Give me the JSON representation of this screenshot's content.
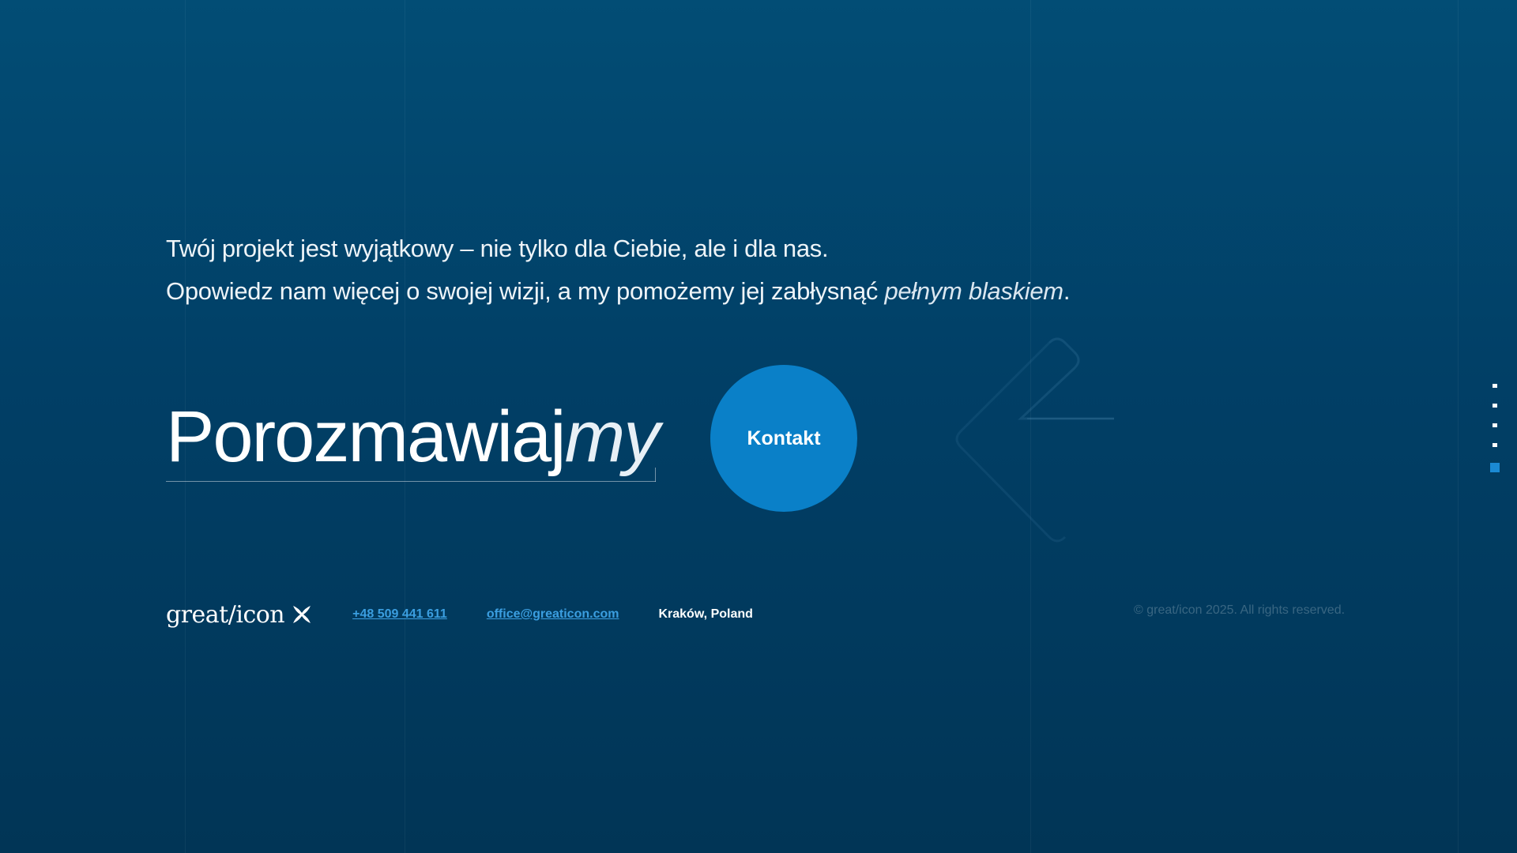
{
  "intro": {
    "line1": "Twój projekt jest wyjątkowy – nie tylko dla Ciebie, ale i dla nas.",
    "line2_start": "Opowiedz nam więcej o swojej wizji, a my pomożemy jej zabłysnąć ",
    "line2_emphasis": "pełnym blaskiem",
    "line2_end": "."
  },
  "heading": {
    "main": "Porozmawiaj",
    "italic": "my"
  },
  "contact_button": {
    "label": "Kontakt"
  },
  "footer": {
    "logo_text": "great/icon",
    "phone": "+48 509 441 611",
    "email": "office@greaticon.com",
    "location": "Kraków, Poland",
    "copyright": "© great/icon 2025. All rights reserved."
  },
  "side_nav": {
    "items": 5,
    "active_index": 4
  },
  "colors": {
    "background_top": "#024d75",
    "background_bottom": "#013556",
    "accent": "#0a80c8",
    "link": "#3b9ee0"
  },
  "icons": [
    "logo-x-icon",
    "arrow-left-decoration-icon"
  ]
}
